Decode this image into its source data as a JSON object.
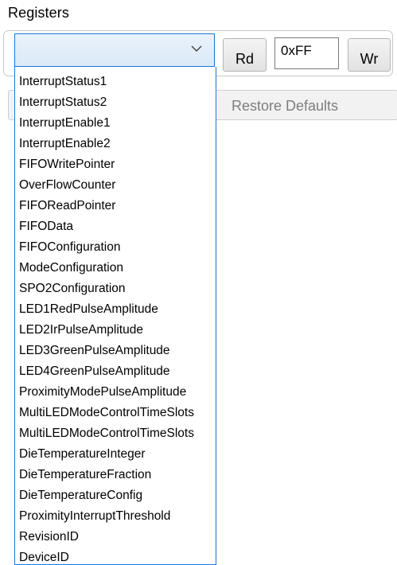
{
  "group": {
    "title": "Registers"
  },
  "combo": {
    "selected": "",
    "icon": "chevron-down-icon"
  },
  "buttons": {
    "read_label": "Rd",
    "write_label": "Wr",
    "restore_label": "Restore Defaults"
  },
  "value_input": {
    "value": "0xFF"
  },
  "dropdown": {
    "options": [
      "InterruptStatus1",
      "InterruptStatus2",
      "InterruptEnable1",
      "InterruptEnable2",
      "FIFOWritePointer",
      "OverFlowCounter",
      "FIFOReadPointer",
      "FIFOData",
      "FIFOConfiguration",
      "ModeConfiguration",
      "SPO2Configuration",
      "LED1RedPulseAmplitude",
      "LED2IrPulseAmplitude",
      "LED3GreenPulseAmplitude",
      "LED4GreenPulseAmplitude",
      "ProximityModePulseAmplitude",
      "MultiLEDModeControlTimeSlots",
      "MultiLEDModeControlTimeSlots",
      "DieTemperatureInteger",
      "DieTemperatureFraction",
      "DieTemperatureConfig",
      "ProximityInterruptThreshold",
      "RevisionID",
      "DeviceID"
    ]
  },
  "colors": {
    "focus_border": "#1e78d7",
    "combo_fill": "#dbe9f8",
    "disabled_text": "#7e7e7e"
  }
}
